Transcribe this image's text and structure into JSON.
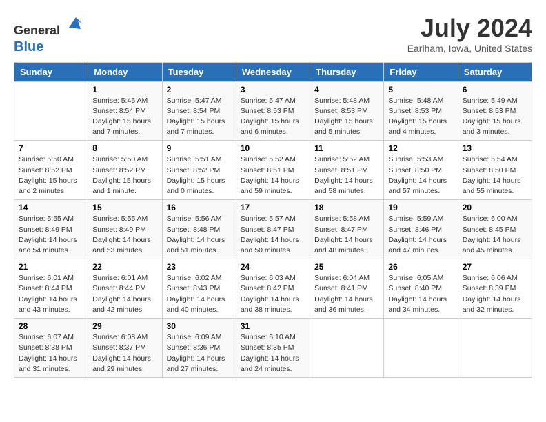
{
  "header": {
    "logo_line1": "General",
    "logo_line2": "Blue",
    "month_year": "July 2024",
    "location": "Earlham, Iowa, United States"
  },
  "weekdays": [
    "Sunday",
    "Monday",
    "Tuesday",
    "Wednesday",
    "Thursday",
    "Friday",
    "Saturday"
  ],
  "weeks": [
    [
      {
        "day": "",
        "detail": ""
      },
      {
        "day": "1",
        "detail": "Sunrise: 5:46 AM\nSunset: 8:54 PM\nDaylight: 15 hours\nand 7 minutes."
      },
      {
        "day": "2",
        "detail": "Sunrise: 5:47 AM\nSunset: 8:54 PM\nDaylight: 15 hours\nand 7 minutes."
      },
      {
        "day": "3",
        "detail": "Sunrise: 5:47 AM\nSunset: 8:53 PM\nDaylight: 15 hours\nand 6 minutes."
      },
      {
        "day": "4",
        "detail": "Sunrise: 5:48 AM\nSunset: 8:53 PM\nDaylight: 15 hours\nand 5 minutes."
      },
      {
        "day": "5",
        "detail": "Sunrise: 5:48 AM\nSunset: 8:53 PM\nDaylight: 15 hours\nand 4 minutes."
      },
      {
        "day": "6",
        "detail": "Sunrise: 5:49 AM\nSunset: 8:53 PM\nDaylight: 15 hours\nand 3 minutes."
      }
    ],
    [
      {
        "day": "7",
        "detail": "Sunrise: 5:50 AM\nSunset: 8:52 PM\nDaylight: 15 hours\nand 2 minutes."
      },
      {
        "day": "8",
        "detail": "Sunrise: 5:50 AM\nSunset: 8:52 PM\nDaylight: 15 hours\nand 1 minute."
      },
      {
        "day": "9",
        "detail": "Sunrise: 5:51 AM\nSunset: 8:52 PM\nDaylight: 15 hours\nand 0 minutes."
      },
      {
        "day": "10",
        "detail": "Sunrise: 5:52 AM\nSunset: 8:51 PM\nDaylight: 14 hours\nand 59 minutes."
      },
      {
        "day": "11",
        "detail": "Sunrise: 5:52 AM\nSunset: 8:51 PM\nDaylight: 14 hours\nand 58 minutes."
      },
      {
        "day": "12",
        "detail": "Sunrise: 5:53 AM\nSunset: 8:50 PM\nDaylight: 14 hours\nand 57 minutes."
      },
      {
        "day": "13",
        "detail": "Sunrise: 5:54 AM\nSunset: 8:50 PM\nDaylight: 14 hours\nand 55 minutes."
      }
    ],
    [
      {
        "day": "14",
        "detail": "Sunrise: 5:55 AM\nSunset: 8:49 PM\nDaylight: 14 hours\nand 54 minutes."
      },
      {
        "day": "15",
        "detail": "Sunrise: 5:55 AM\nSunset: 8:49 PM\nDaylight: 14 hours\nand 53 minutes."
      },
      {
        "day": "16",
        "detail": "Sunrise: 5:56 AM\nSunset: 8:48 PM\nDaylight: 14 hours\nand 51 minutes."
      },
      {
        "day": "17",
        "detail": "Sunrise: 5:57 AM\nSunset: 8:47 PM\nDaylight: 14 hours\nand 50 minutes."
      },
      {
        "day": "18",
        "detail": "Sunrise: 5:58 AM\nSunset: 8:47 PM\nDaylight: 14 hours\nand 48 minutes."
      },
      {
        "day": "19",
        "detail": "Sunrise: 5:59 AM\nSunset: 8:46 PM\nDaylight: 14 hours\nand 47 minutes."
      },
      {
        "day": "20",
        "detail": "Sunrise: 6:00 AM\nSunset: 8:45 PM\nDaylight: 14 hours\nand 45 minutes."
      }
    ],
    [
      {
        "day": "21",
        "detail": "Sunrise: 6:01 AM\nSunset: 8:44 PM\nDaylight: 14 hours\nand 43 minutes."
      },
      {
        "day": "22",
        "detail": "Sunrise: 6:01 AM\nSunset: 8:44 PM\nDaylight: 14 hours\nand 42 minutes."
      },
      {
        "day": "23",
        "detail": "Sunrise: 6:02 AM\nSunset: 8:43 PM\nDaylight: 14 hours\nand 40 minutes."
      },
      {
        "day": "24",
        "detail": "Sunrise: 6:03 AM\nSunset: 8:42 PM\nDaylight: 14 hours\nand 38 minutes."
      },
      {
        "day": "25",
        "detail": "Sunrise: 6:04 AM\nSunset: 8:41 PM\nDaylight: 14 hours\nand 36 minutes."
      },
      {
        "day": "26",
        "detail": "Sunrise: 6:05 AM\nSunset: 8:40 PM\nDaylight: 14 hours\nand 34 minutes."
      },
      {
        "day": "27",
        "detail": "Sunrise: 6:06 AM\nSunset: 8:39 PM\nDaylight: 14 hours\nand 32 minutes."
      }
    ],
    [
      {
        "day": "28",
        "detail": "Sunrise: 6:07 AM\nSunset: 8:38 PM\nDaylight: 14 hours\nand 31 minutes."
      },
      {
        "day": "29",
        "detail": "Sunrise: 6:08 AM\nSunset: 8:37 PM\nDaylight: 14 hours\nand 29 minutes."
      },
      {
        "day": "30",
        "detail": "Sunrise: 6:09 AM\nSunset: 8:36 PM\nDaylight: 14 hours\nand 27 minutes."
      },
      {
        "day": "31",
        "detail": "Sunrise: 6:10 AM\nSunset: 8:35 PM\nDaylight: 14 hours\nand 24 minutes."
      },
      {
        "day": "",
        "detail": ""
      },
      {
        "day": "",
        "detail": ""
      },
      {
        "day": "",
        "detail": ""
      }
    ]
  ]
}
